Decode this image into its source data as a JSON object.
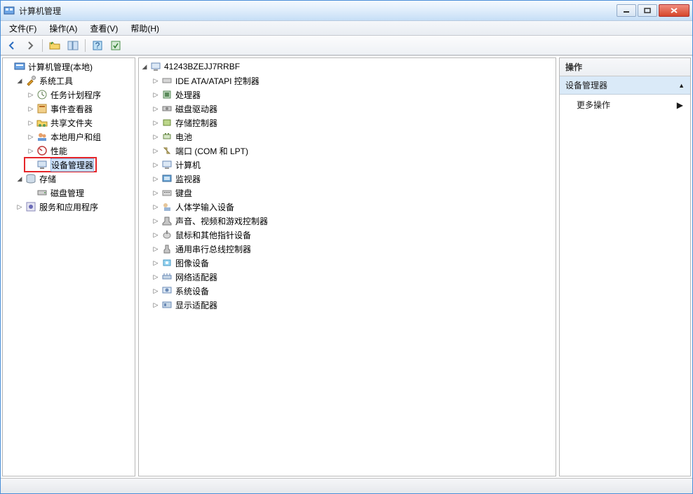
{
  "window": {
    "title": "计算机管理"
  },
  "menu": {
    "file": "文件(F)",
    "action": "操作(A)",
    "view": "查看(V)",
    "help": "帮助(H)"
  },
  "left_tree": {
    "root": "计算机管理(本地)",
    "system_tools": {
      "label": "系统工具",
      "children": {
        "task_scheduler": "任务计划程序",
        "event_viewer": "事件查看器",
        "shared_folders": "共享文件夹",
        "local_users": "本地用户和组",
        "performance": "性能",
        "device_manager": "设备管理器"
      }
    },
    "storage": {
      "label": "存储",
      "disk_mgmt": "磁盘管理"
    },
    "services_apps": "服务和应用程序"
  },
  "devmgr": {
    "computer_name": "41243BZEJJ7RRBF",
    "categories": [
      "IDE ATA/ATAPI 控制器",
      "处理器",
      "磁盘驱动器",
      "存储控制器",
      "电池",
      "端口 (COM 和 LPT)",
      "计算机",
      "监视器",
      "键盘",
      "人体学输入设备",
      "声音、视频和游戏控制器",
      "鼠标和其他指针设备",
      "通用串行总线控制器",
      "图像设备",
      "网络适配器",
      "系统设备",
      "显示适配器"
    ]
  },
  "actions": {
    "header": "操作",
    "section": "设备管理器",
    "more": "更多操作"
  }
}
